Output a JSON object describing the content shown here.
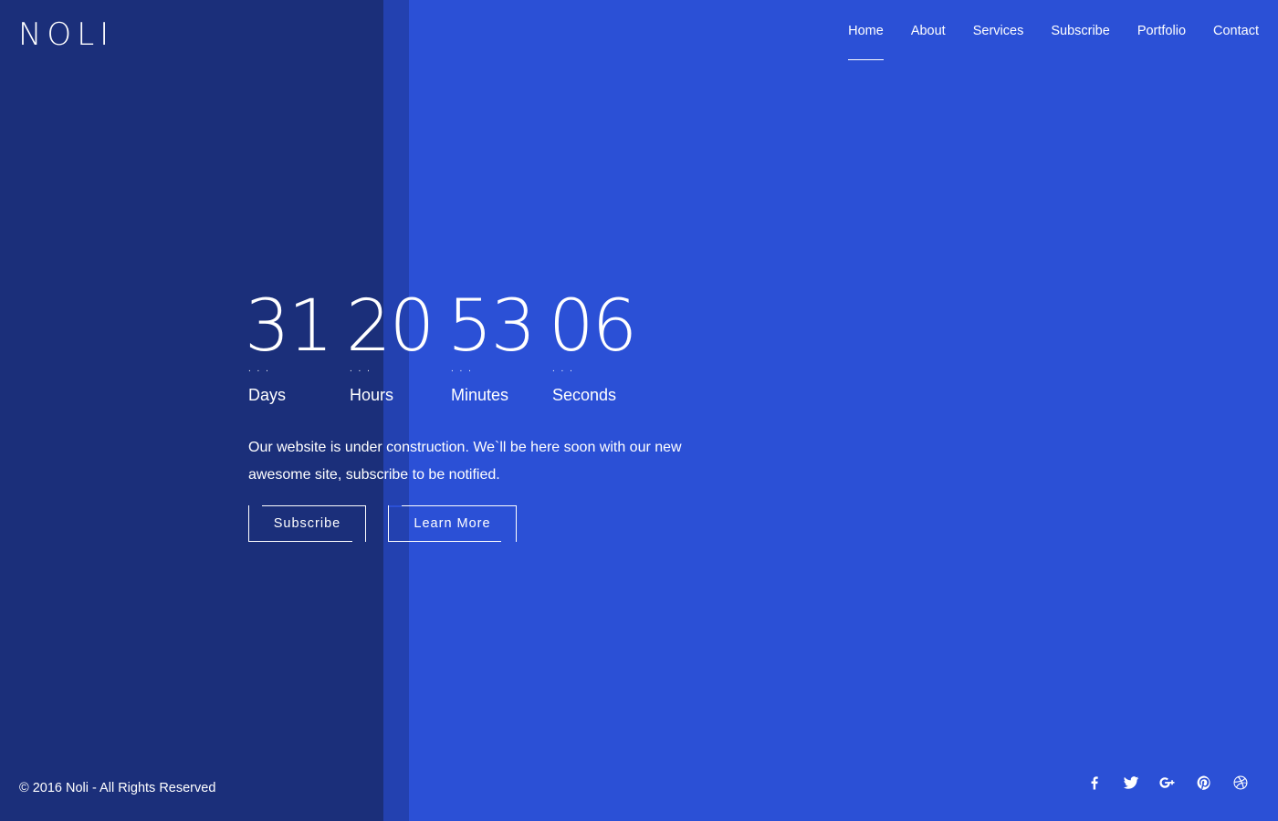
{
  "brand": {
    "logo_text": "NOLI"
  },
  "nav": {
    "items": [
      {
        "label": "Home",
        "active": true
      },
      {
        "label": "About"
      },
      {
        "label": "Services"
      },
      {
        "label": "Subscribe"
      },
      {
        "label": "Portfolio"
      },
      {
        "label": "Contact"
      }
    ]
  },
  "countdown": {
    "days": {
      "value": "31",
      "label": "Days"
    },
    "hours": {
      "value": "20",
      "label": "Hours"
    },
    "minutes": {
      "value": "53",
      "label": "Minutes"
    },
    "seconds": {
      "value": "06",
      "label": "Seconds"
    },
    "dots": ". . ."
  },
  "message": {
    "text": "Our website is under construction. We`ll be here soon with our new awesome site, subscribe to be notified."
  },
  "buttons": {
    "subscribe": "Subscribe",
    "learn_more": "Learn More"
  },
  "footer": {
    "copyright": "© 2016 Noli - All Rights Reserved",
    "social": [
      "facebook-icon",
      "twitter-icon",
      "google-plus-icon",
      "pinterest-icon",
      "dribbble-icon"
    ]
  },
  "colors": {
    "background": "#2b50d6",
    "left_panel": "#1b2f7a",
    "text": "#ffffff"
  }
}
